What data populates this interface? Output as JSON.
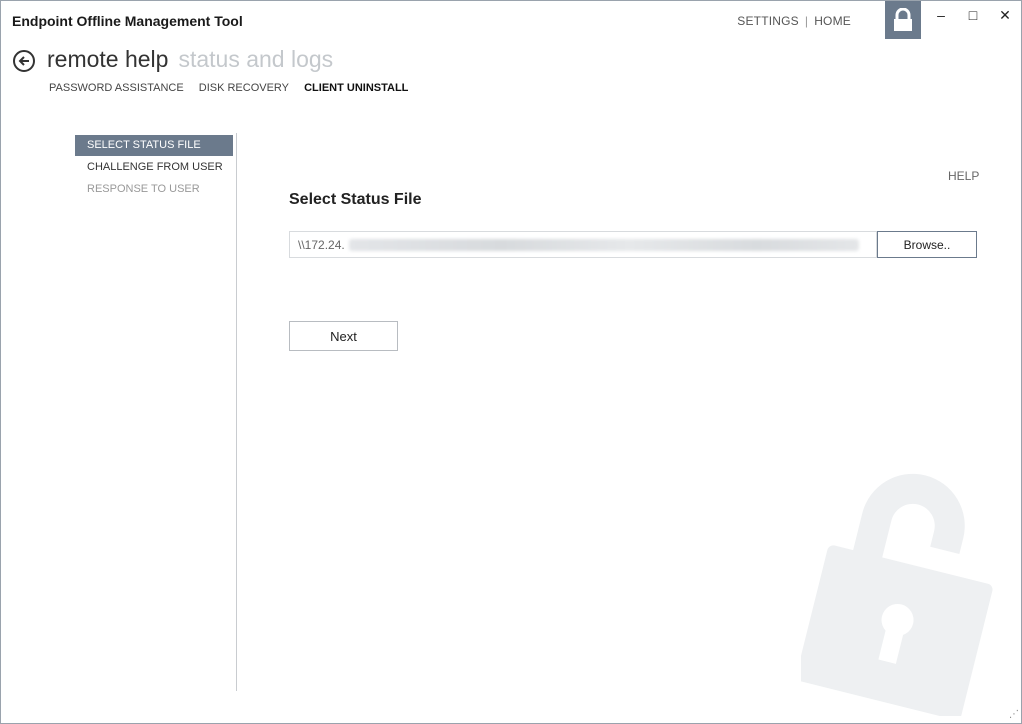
{
  "window": {
    "title": "Endpoint Offline Management Tool",
    "controls": {
      "minimize": "‒",
      "maximize": "□",
      "close": "✕"
    }
  },
  "top_nav": {
    "settings": "SETTINGS",
    "separator": "|",
    "home": "HOME"
  },
  "header": {
    "active": "remote help",
    "inactive": "status and logs"
  },
  "subnav": {
    "items": [
      "PASSWORD ASSISTANCE",
      "DISK RECOVERY",
      "CLIENT UNINSTALL"
    ],
    "selected": "CLIENT UNINSTALL"
  },
  "steps": [
    {
      "label": "SELECT STATUS FILE",
      "state": "current"
    },
    {
      "label": "CHALLENGE FROM USER",
      "state": "enabled"
    },
    {
      "label": "RESPONSE TO USER",
      "state": "disabled"
    }
  ],
  "main": {
    "help": "HELP",
    "title": "Select Status File",
    "path_value": "\\\\172.24.",
    "browse_label": "Browse..",
    "next_label": "Next"
  },
  "colors": {
    "accent": "#6b7a8c",
    "watermark": "#eef0f2"
  },
  "icons": {
    "back": "back-arrow-icon",
    "lock_tile": "lock-icon",
    "watermark": "open-padlock-icon"
  }
}
